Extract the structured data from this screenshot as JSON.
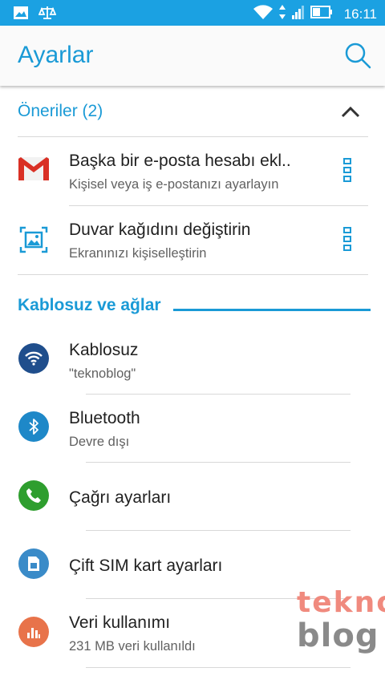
{
  "status_bar": {
    "time": "16:11"
  },
  "app_bar": {
    "title": "Ayarlar"
  },
  "suggestions": {
    "header": "Öneriler (2)",
    "items": [
      {
        "title": "Başka bir e-posta hesabı ekl..",
        "subtitle": "Kişisel veya iş e-postanızı ayarlayın",
        "icon": "gmail-icon"
      },
      {
        "title": "Duvar kağıdını değiştirin",
        "subtitle": "Ekranınızı kişiselleştirin",
        "icon": "wallpaper-icon"
      }
    ]
  },
  "wireless": {
    "header": "Kablosuz ve ağlar",
    "items": [
      {
        "title": "Kablosuz",
        "subtitle": "\"teknoblog\"",
        "icon": "wifi-icon",
        "color": "#1f4e8c"
      },
      {
        "title": "Bluetooth",
        "subtitle": "Devre dışı",
        "icon": "bluetooth-icon",
        "color": "#1e88c8"
      },
      {
        "title": "Çağrı ayarları",
        "subtitle": "",
        "icon": "phone-icon",
        "color": "#2e9e2e"
      },
      {
        "title": "Çift SIM kart ayarları",
        "subtitle": "",
        "icon": "sim-card-icon",
        "color": "#3a8bc8"
      },
      {
        "title": "Veri kullanımı",
        "subtitle": "231 MB veri kullanıldı",
        "icon": "data-usage-icon",
        "color": "#e8734a"
      }
    ]
  },
  "watermark": {
    "line1": "tekno",
    "line2": "blog"
  }
}
